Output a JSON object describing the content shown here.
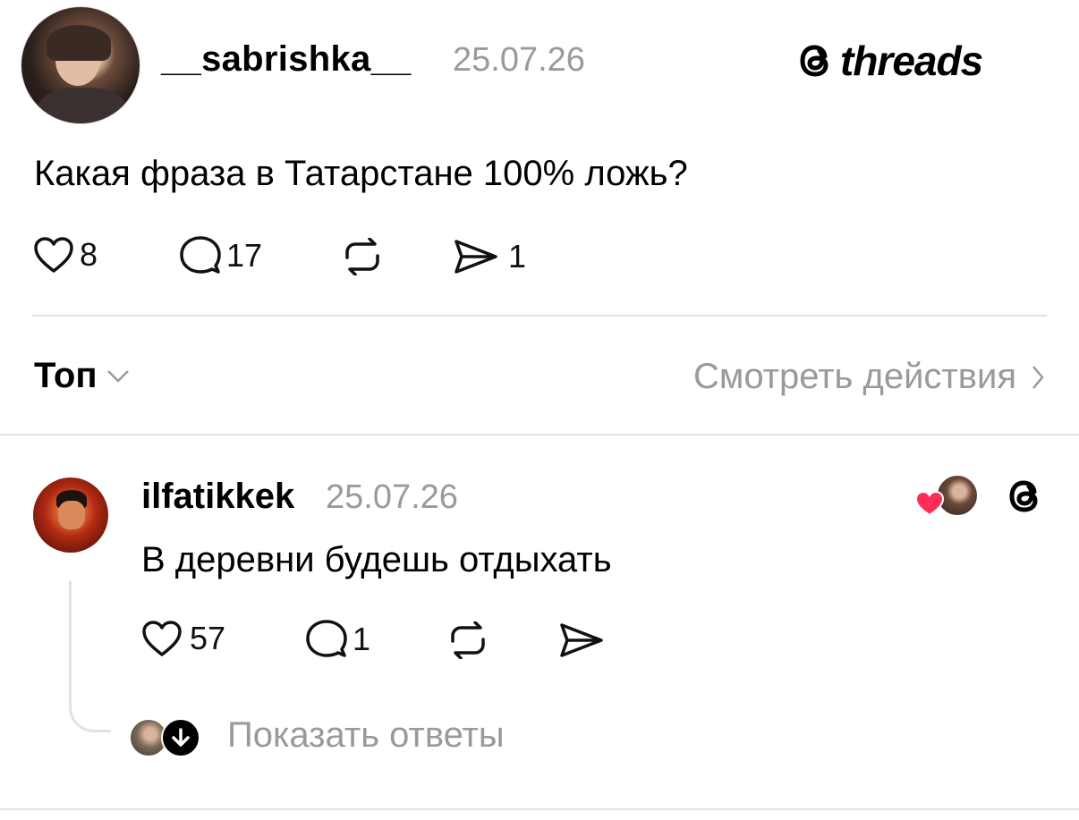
{
  "post": {
    "username": "__sabrishka__",
    "date": "25.07.26",
    "text": "Какая фраза в Татарстане 100% ложь?",
    "likes": "8",
    "replies": "17",
    "reposts": "",
    "shares": "1"
  },
  "brand": {
    "name": "threads"
  },
  "sort": {
    "label": "Топ",
    "view_activity": "Смотреть действия"
  },
  "reply": {
    "username": "ilfatikkek",
    "date": "25.07.26",
    "text": "В деревни будешь отдыхать",
    "likes": "57",
    "replies": "1",
    "show_replies": "Показать ответы"
  },
  "colors": {
    "heart_red": "#ff2d55",
    "muted": "#9a9a9a",
    "divider": "#e2e2e2"
  },
  "icons": [
    "heart-icon",
    "comment-icon",
    "repost-icon",
    "share-icon",
    "chevron-down-icon",
    "chevron-right-icon",
    "threads-logo-icon",
    "arrow-down-icon"
  ]
}
